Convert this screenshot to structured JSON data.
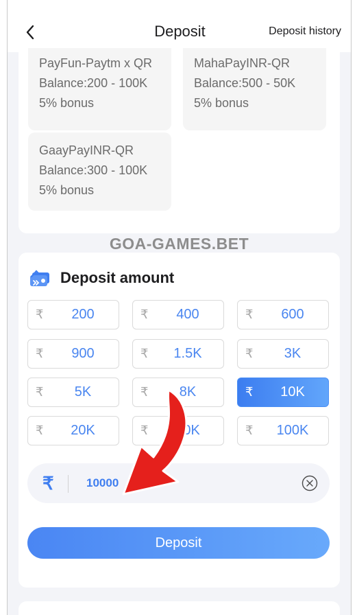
{
  "header": {
    "title": "Deposit",
    "history_label": "Deposit history"
  },
  "channels": [
    {
      "name": "PayFun-Paytm x QR",
      "balance": "Balance:200 - 100K",
      "bonus": "5% bonus"
    },
    {
      "name": "MahaPayINR-QR",
      "balance": "Balance:500 - 50K",
      "bonus": "5% bonus"
    },
    {
      "name": "GaayPayINR-QR",
      "balance": "Balance:300 - 100K",
      "bonus": "5% bonus"
    }
  ],
  "watermark": "GOA-GAMES.BET",
  "amount": {
    "title": "Deposit amount",
    "currency": "₹",
    "options": [
      "200",
      "400",
      "600",
      "900",
      "1.5K",
      "3K",
      "5K",
      "8K",
      "10K",
      "20K",
      "50K",
      "100K"
    ],
    "selected": "10K",
    "input_value": "10000"
  },
  "deposit_button": "Deposit",
  "colors": {
    "accent": "#3f7ef0",
    "accent_light": "#68a9fb",
    "annotation_arrow": "#e5201c"
  }
}
